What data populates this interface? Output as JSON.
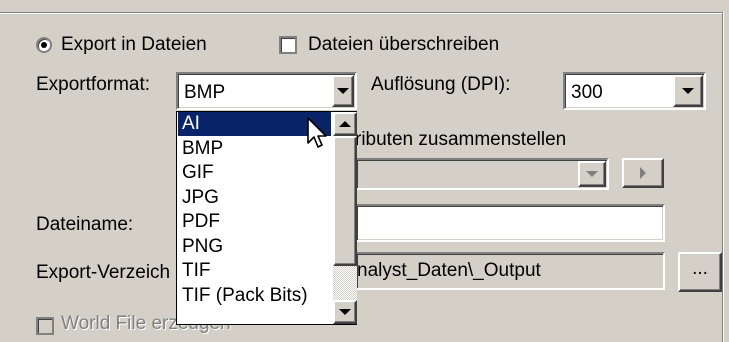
{
  "export_to_files": {
    "label": "Export in Dateien",
    "selected": true
  },
  "overwrite_files": {
    "label": "Dateien überschreiben",
    "checked": false
  },
  "export_format": {
    "label": "Exportformat:",
    "value": "BMP"
  },
  "resolution": {
    "label": "Auflösung (DPI):",
    "value": "300"
  },
  "compose_from_attributes": {
    "visible_label": "ributen zusammenstellen"
  },
  "next_button_label": ">",
  "filename": {
    "label": "Dateiname:",
    "value": ""
  },
  "export_directory": {
    "label": "Export-Verzeich",
    "visible_value": "nalyst_Daten\\_Output",
    "browse_label": "..."
  },
  "world_file": {
    "label": "World File erzeugen",
    "checked": false
  },
  "format_options": {
    "items": [
      "AI",
      "BMP",
      "GIF",
      "JPG",
      "PDF",
      "PNG",
      "TIF",
      "TIF (Pack Bits)"
    ],
    "highlighted": "AI"
  },
  "colors": {
    "highlight": "#0a246a",
    "window": "#d4d0c8"
  },
  "icons": {
    "cursor": "arrow-cursor-icon"
  }
}
